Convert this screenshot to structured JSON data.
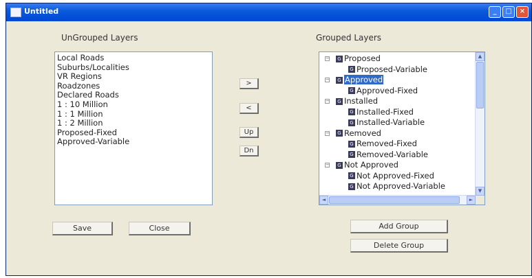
{
  "window": {
    "title": "Untitled"
  },
  "titlebar_buttons": {
    "minimize": "_",
    "maximize": "□",
    "close": "×"
  },
  "labels": {
    "ungrouped": "UnGrouped Layers",
    "grouped": "Grouped Layers"
  },
  "ungrouped_layers": [
    "Local Roads",
    "Suburbs/Localities",
    "VR Regions",
    "Roadzones",
    "Declared Roads",
    "1 : 10 Million",
    "1 : 1 Million",
    "1 : 2 Million",
    "Proposed-Fixed",
    "Approved-Variable"
  ],
  "grouped_tree": [
    {
      "label": "Proposed",
      "expander": "−",
      "children": [
        "Proposed-Variable"
      ]
    },
    {
      "label": "Approved",
      "expander": "−",
      "selected": true,
      "children": [
        "Approved-Fixed"
      ]
    },
    {
      "label": "Installed",
      "expander": "−",
      "children": [
        "Installed-Fixed",
        "Installed-Variable"
      ]
    },
    {
      "label": "Removed",
      "expander": "−",
      "children": [
        "Removed-Fixed",
        "Removed-Variable"
      ]
    },
    {
      "label": "Not Approved",
      "expander": "−",
      "children": [
        "Not Approved-Fixed",
        "Not Approved-Variable"
      ]
    }
  ],
  "move_buttons": {
    "add": ">",
    "remove": "<",
    "up": "Up",
    "down": "Dn"
  },
  "buttons": {
    "save": "Save",
    "close": "Close",
    "add_group": "Add Group",
    "delete_group": "Delete Group"
  },
  "node_icon_glyph": "G",
  "colors": {
    "titlebar": "#0054e3",
    "selection": "#316ac5",
    "face": "#ece9d8"
  }
}
